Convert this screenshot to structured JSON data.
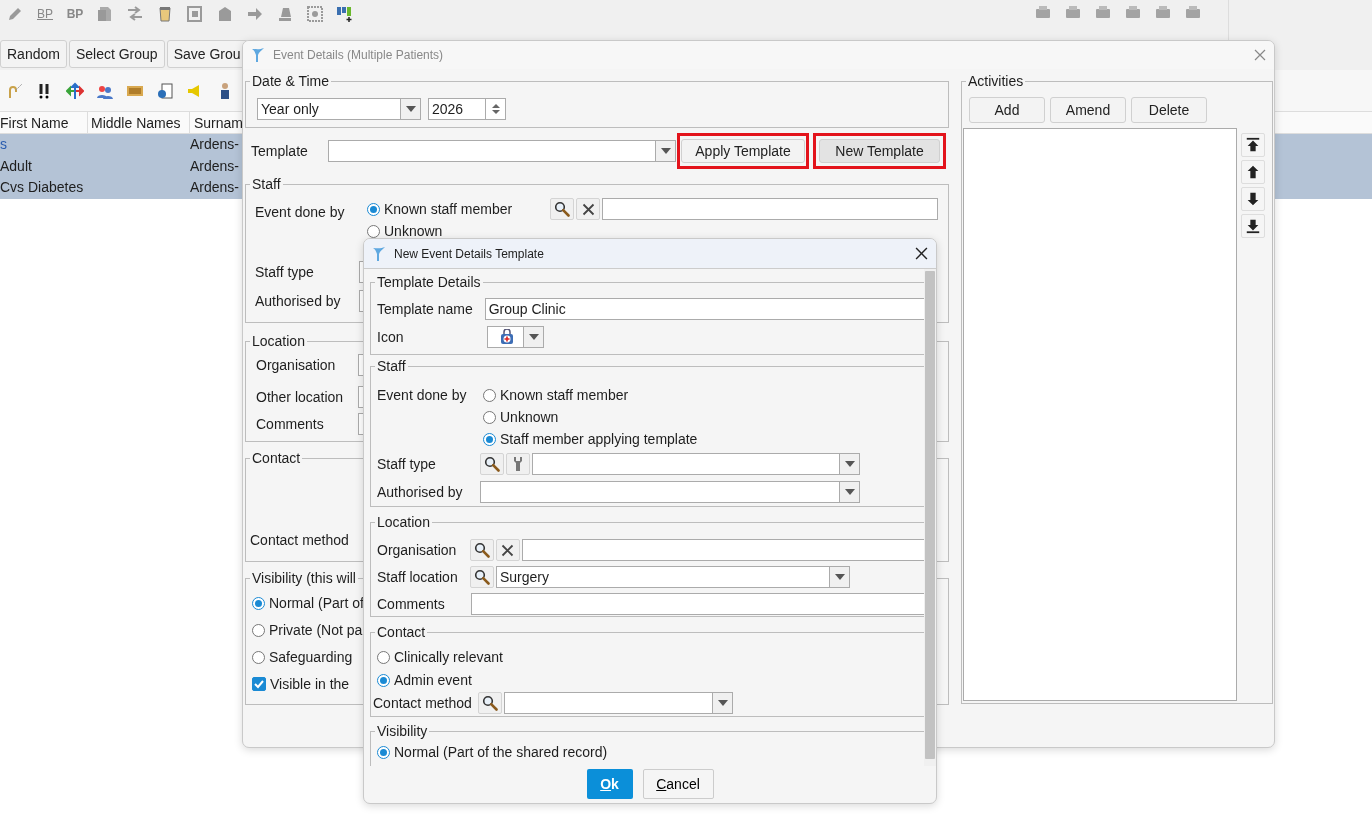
{
  "app": {
    "toolbar_labels": [
      "BP",
      "BP"
    ],
    "group_buttons": [
      "Random",
      "Select Group",
      "Save Grou"
    ],
    "table": {
      "columns": [
        "First Name",
        "Middle Names",
        "Surnam"
      ],
      "rows": [
        {
          "first_name": "s",
          "surname": "Ardens-",
          "selected": true
        },
        {
          "first_name": "Adult",
          "surname": "Ardens-",
          "selected": true
        },
        {
          "first_name": "Cvs Diabetes",
          "surname": "Ardens-",
          "selected": true
        }
      ]
    }
  },
  "event_dialog": {
    "title": "Event Details (Multiple Patients)",
    "date_time": {
      "legend": "Date & Time",
      "precision": "Year only",
      "year": "2026"
    },
    "template": {
      "label": "Template",
      "buttons": [
        {
          "label": "Apply Template",
          "highlighted": true
        },
        {
          "label": "New Template",
          "highlighted": true
        }
      ]
    },
    "staff": {
      "legend": "Staff",
      "event_done_by": "Event done by",
      "options": [
        {
          "label": "Known staff member",
          "selected": true
        },
        {
          "label": "Unknown",
          "selected": false
        }
      ],
      "staff_type": "Staff type",
      "authorised_by": "Authorised by"
    },
    "location": {
      "legend": "Location",
      "labels": [
        "Organisation",
        "Other location",
        "Comments"
      ]
    },
    "contact": {
      "legend": "Contact",
      "contact_method": "Contact method"
    },
    "visibility": {
      "legend": "Visibility (this will",
      "options": [
        {
          "label": "Normal (Part of",
          "selected": true
        },
        {
          "label": "Private (Not pa",
          "selected": false
        },
        {
          "label": "Safeguarding",
          "selected": false
        }
      ],
      "visible": {
        "label": "Visible in the",
        "checked": true
      }
    },
    "activities": {
      "legend": "Activities",
      "buttons": [
        "Add",
        "Amend",
        "Delete"
      ]
    }
  },
  "template_dialog": {
    "title": "New Event Details Template",
    "details": {
      "legend": "Template Details",
      "name_label": "Template name",
      "name": "Group Clinic",
      "icon_label": "Icon"
    },
    "staff": {
      "legend": "Staff",
      "event_done_by": "Event done by",
      "options": [
        {
          "label": "Known staff member",
          "selected": false
        },
        {
          "label": "Unknown",
          "selected": false
        },
        {
          "label": "Staff member applying template",
          "selected": true
        }
      ],
      "staff_type": "Staff type",
      "authorised_by": "Authorised by"
    },
    "location": {
      "legend": "Location",
      "organisation": "Organisation",
      "staff_location": "Staff location",
      "staff_location_value": "Surgery",
      "comments": "Comments"
    },
    "contact": {
      "legend": "Contact",
      "options": [
        {
          "label": "Clinically relevant",
          "selected": false
        },
        {
          "label": "Admin event",
          "selected": true
        }
      ],
      "contact_method": "Contact method"
    },
    "visibility": {
      "legend": "Visibility",
      "options": [
        {
          "label": "Normal (Part of the shared record)",
          "selected": true
        }
      ]
    },
    "buttons": [
      "Ok",
      "Cancel"
    ]
  }
}
